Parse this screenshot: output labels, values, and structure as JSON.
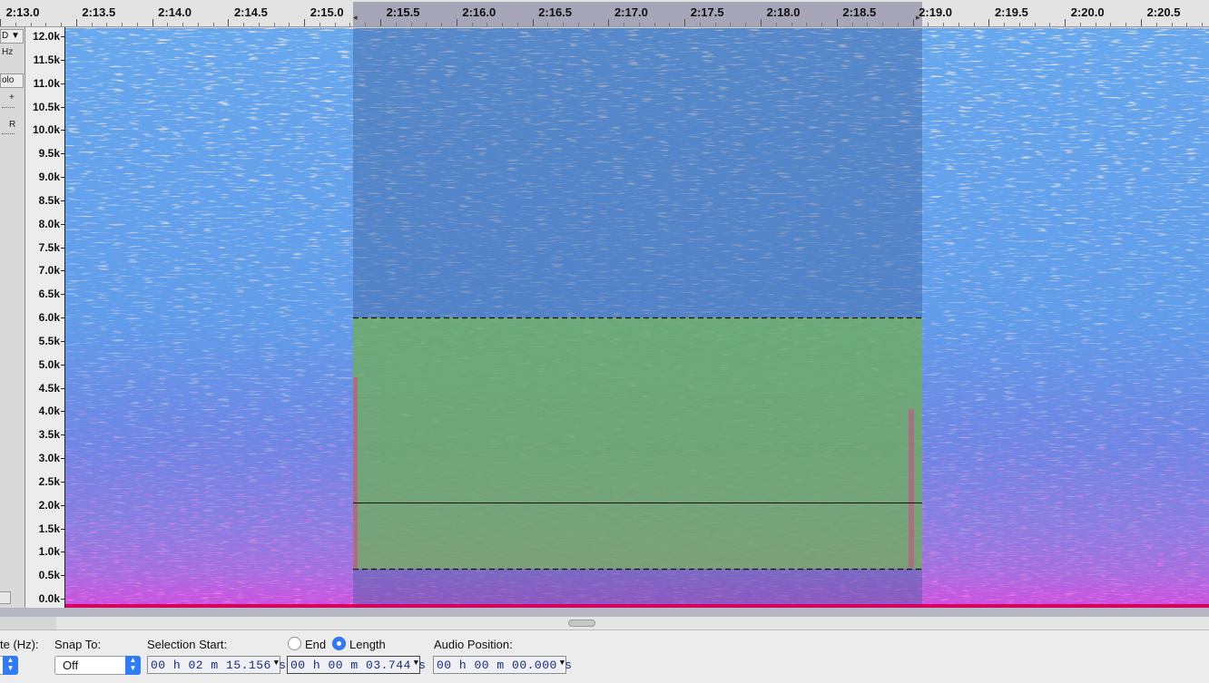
{
  "ruler": {
    "ticks": [
      "2:13.0",
      "2:13.5",
      "2:14.0",
      "2:14.5",
      "2:15.0",
      "2:15.5",
      "2:16.0",
      "2:16.5",
      "2:17.0",
      "2:17.5",
      "2:18.0",
      "2:18.5",
      "2:19.0",
      "2:19.5",
      "2:20.0",
      "2:20.5"
    ]
  },
  "track_panel": {
    "menu_label": "D ▼",
    "rate_label": "Hz",
    "solo_label": "olo",
    "gain_plus": "+",
    "pan_right": "R"
  },
  "frequency_axis": {
    "labels": [
      "12.0k",
      "11.5k",
      "11.0k",
      "10.5k",
      "10.0k",
      "9.5k",
      "9.0k",
      "8.5k",
      "8.0k",
      "7.5k",
      "7.0k",
      "6.5k",
      "6.0k",
      "5.5k",
      "5.0k",
      "4.5k",
      "4.0k",
      "3.5k",
      "3.0k",
      "2.5k",
      "2.0k",
      "1.5k",
      "1.0k",
      "0.5k",
      "0.0k"
    ]
  },
  "spectrogram": {
    "colors": {
      "background": "#5ea1ec",
      "noise_light": "#bdb3ad",
      "low_freq": "#d24fe0",
      "selection_time_tint": "#3d5f9a",
      "selection_freq_tint": "#67a257",
      "bottom_line": "#d8005e"
    }
  },
  "toolbar": {
    "rate_label": "te (Hz):",
    "snap_label": "Snap To:",
    "snap_value": "Off",
    "selection_start_label": "Selection Start:",
    "selection_start_value": "00 h 02 m 15.156 s",
    "end_label": "End",
    "length_label": "Length",
    "length_value": "00 h 00 m 03.744 s",
    "audio_position_label": "Audio Position:",
    "audio_position_value": "00 h 00 m 00.000 s"
  }
}
